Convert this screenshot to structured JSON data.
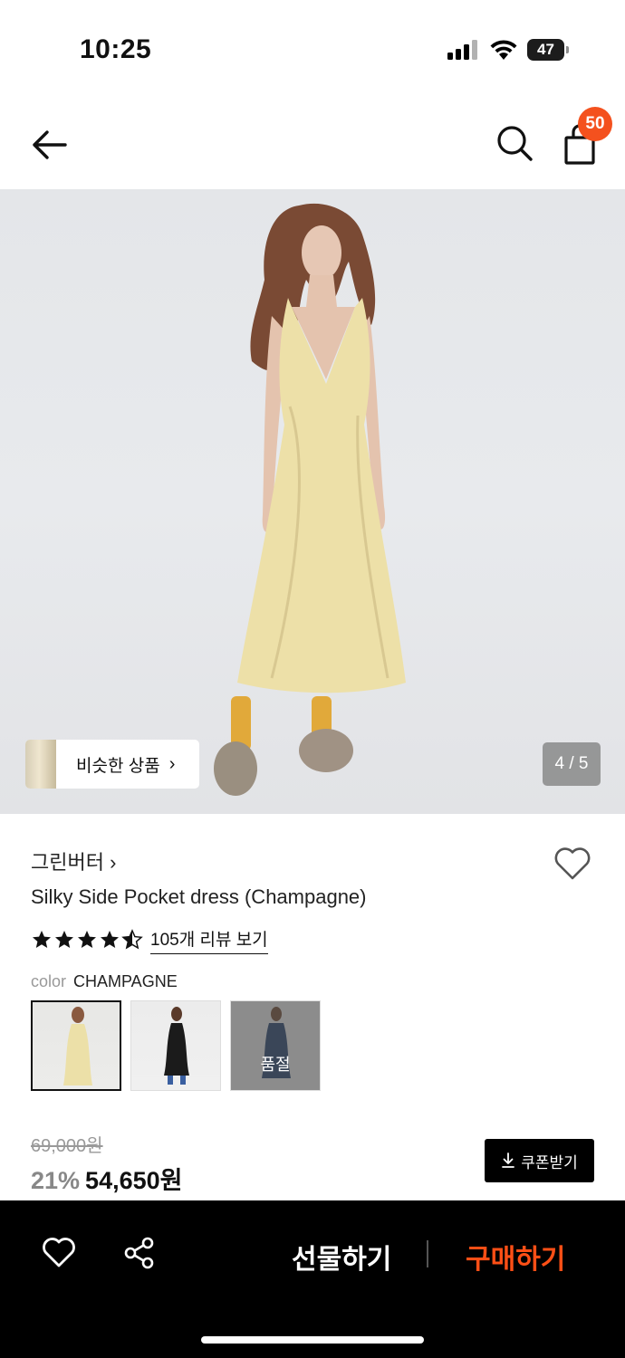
{
  "status": {
    "time": "10:25",
    "battery": "47"
  },
  "header": {
    "cart_count": "50"
  },
  "gallery": {
    "similar_label": "비슷한 상품",
    "page_indicator": "4 / 5"
  },
  "product": {
    "brand": "그린버터 ›",
    "title": "Silky Side Pocket dress (Champagne)",
    "rating": 4.5,
    "review_link": "105개 리뷰 보기",
    "color_label": "color",
    "color_value": "CHAMPAGNE",
    "swatches": [
      {
        "name": "champagne",
        "selected": true,
        "soldout": false
      },
      {
        "name": "black",
        "selected": false,
        "soldout": false
      },
      {
        "name": "navy",
        "selected": false,
        "soldout": true,
        "soldout_label": "품절"
      }
    ],
    "original_price": "69,000원",
    "discount": "21%",
    "sale_price": "54,650원",
    "coupon_label": "쿠폰받기"
  },
  "bottom_bar": {
    "gift_label": "선물하기",
    "buy_label": "구매하기"
  },
  "colors": {
    "accent": "#f4511e",
    "buy": "#ff4f16",
    "bar": "#000000"
  }
}
